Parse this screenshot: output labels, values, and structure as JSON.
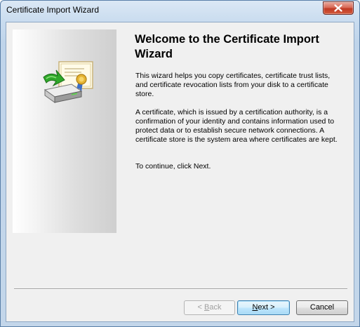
{
  "window": {
    "title": "Certificate Import Wizard"
  },
  "icons": {
    "close": "close-icon",
    "wizard_graphic": "certificate-import-icon"
  },
  "content": {
    "heading": "Welcome to the Certificate Import Wizard",
    "paragraph1": "This wizard helps you copy certificates, certificate trust lists, and certificate revocation lists from your disk to a certificate store.",
    "paragraph2": "A certificate, which is issued by a certification authority, is a confirmation of your identity and contains information used to protect data or to establish secure network connections. A certificate store is the system area where certificates are kept.",
    "paragraph3": "To continue, click Next."
  },
  "buttons": {
    "back": {
      "mnemonic_prefix": "< ",
      "mnemonic": "B",
      "rest": "ack",
      "enabled": false
    },
    "next": {
      "mnemonic": "N",
      "rest": "ext >",
      "enabled": true
    },
    "cancel": {
      "label": "Cancel",
      "enabled": true
    }
  },
  "colors": {
    "title_bar": "#c9dcef",
    "client_background": "#f0f0f0",
    "close_button": "#c03a25",
    "default_button_border": "#3c7fb1"
  }
}
